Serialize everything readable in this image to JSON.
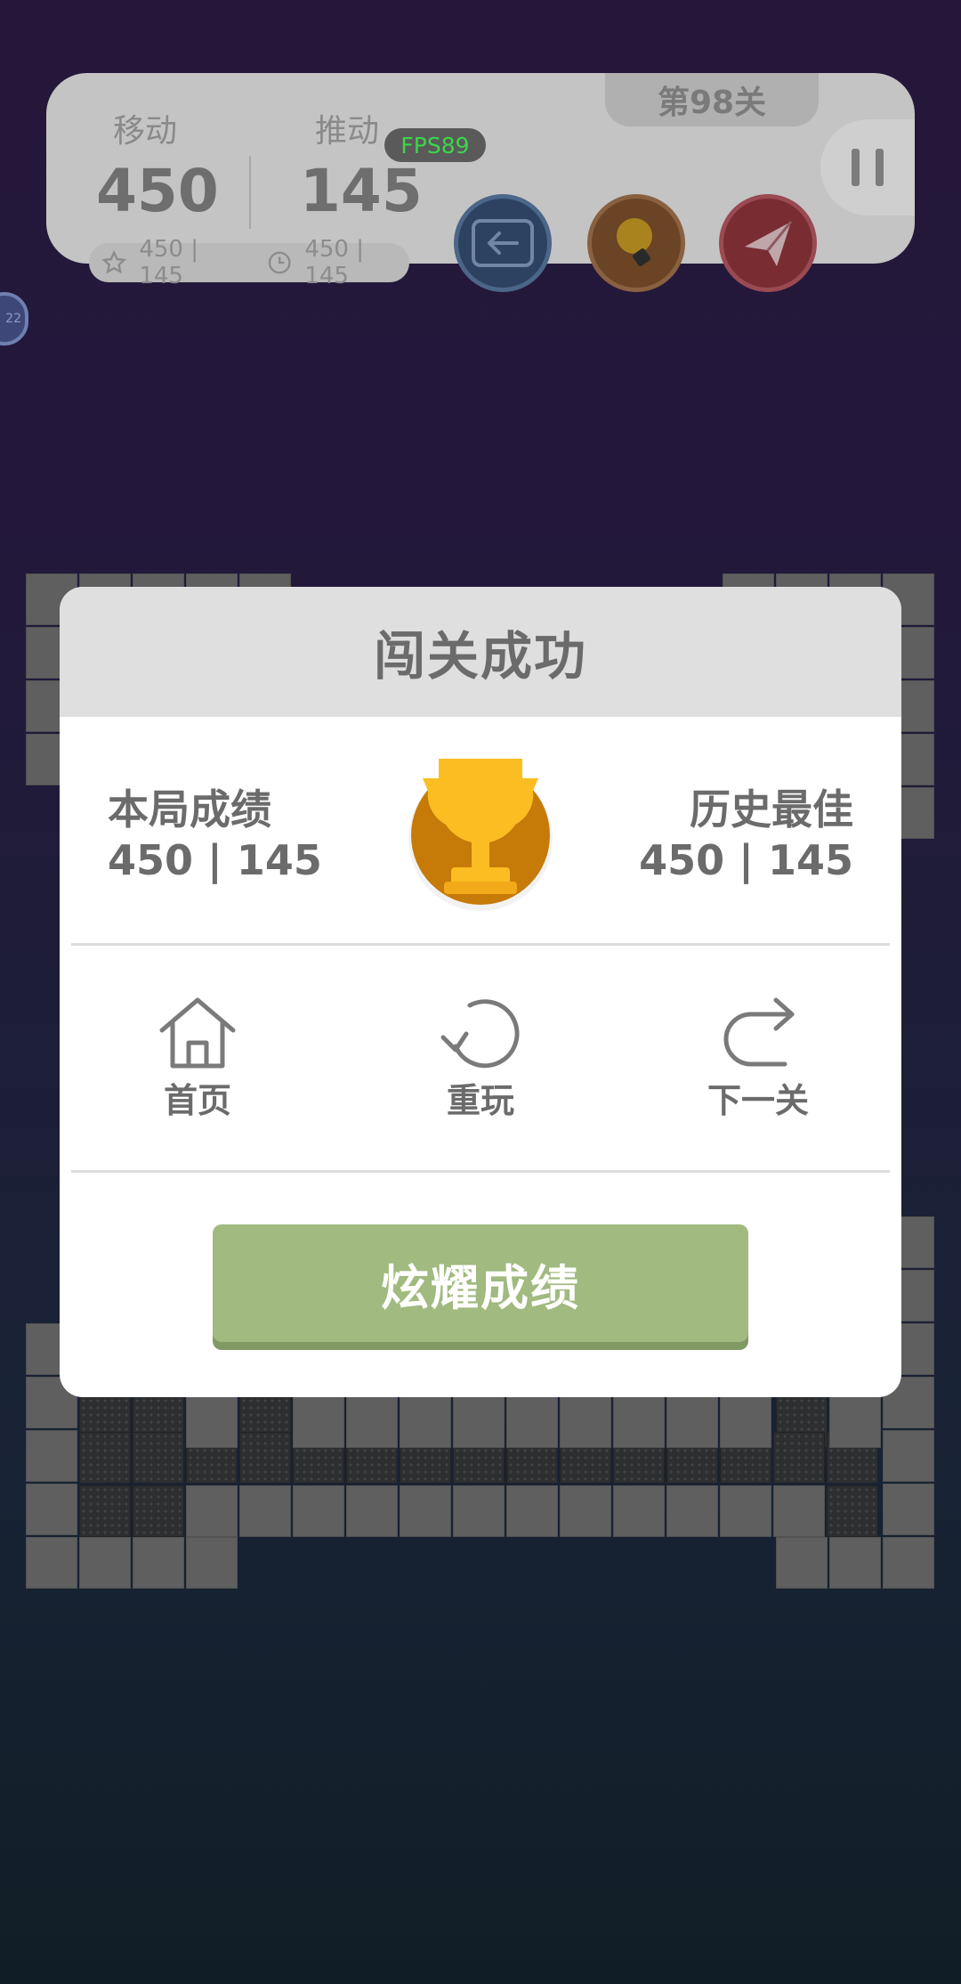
{
  "hud": {
    "moves_label": "移动",
    "moves_value": "450",
    "pushes_label": "推动",
    "pushes_value": "145",
    "level": "第98关",
    "fps": "FPS89",
    "best_star": "450 | 145",
    "best_time": "450 | 145",
    "side_badge": "22",
    "buttons": [
      {
        "name": "undo",
        "icon": "back-arrow-icon",
        "color": "#3f5f8a"
      },
      {
        "name": "hint",
        "icon": "lightbulb-icon",
        "color": "#8a5a2a"
      },
      {
        "name": "share",
        "icon": "paper-plane-icon",
        "color": "#9a3a44"
      }
    ]
  },
  "dialog": {
    "title": "闯关成功",
    "current": {
      "label": "本局成绩",
      "value": "450 | 145"
    },
    "best": {
      "label": "历史最佳",
      "value": "450 | 145"
    },
    "trophy_icon": "trophy-icon",
    "actions": [
      {
        "label": "首页",
        "icon": "home-icon"
      },
      {
        "label": "重玩",
        "icon": "replay-icon"
      },
      {
        "label": "下一关",
        "icon": "next-icon"
      }
    ],
    "share_button": "炫耀成绩"
  },
  "colors": {
    "accent_green": "#a0ba7f",
    "trophy_gold": "#fbbd22",
    "trophy_bronze": "#c67a08"
  }
}
